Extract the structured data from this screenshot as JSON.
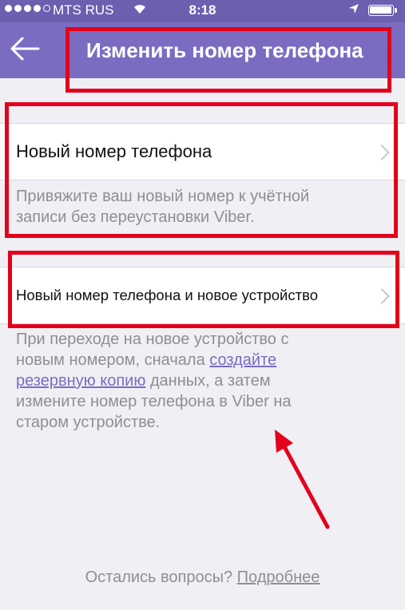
{
  "status_bar": {
    "carrier": "MTS RUS",
    "time": "8:18",
    "wifi_icon": "wifi-icon",
    "location_icon": "location-arrow-icon",
    "battery_icon": "battery-icon"
  },
  "nav": {
    "back_icon": "back-arrow-icon",
    "title": "Изменить номер телефона",
    "bar_color": "#7b6cc2"
  },
  "options": [
    {
      "label": "Новый номер телефона",
      "description_line1": "Привяжите ваш новый номер к учётной",
      "description_line2": "записи без переустановки Viber."
    },
    {
      "label": "Новый номер телефона и новое устройство",
      "description_part1": "При переходе на новое устройство с",
      "description_part2": "новым номером, сначала ",
      "description_link_part1": "создайте",
      "description_link_part2": "резервную копию",
      "description_part3": " данных, а затем",
      "description_part4": "измените номер телефона в Viber на",
      "description_part5": "старом устройстве."
    }
  ],
  "footer": {
    "question": "Остались вопросы? ",
    "link": "Подробнее"
  },
  "annotation_color": "#e3001b"
}
